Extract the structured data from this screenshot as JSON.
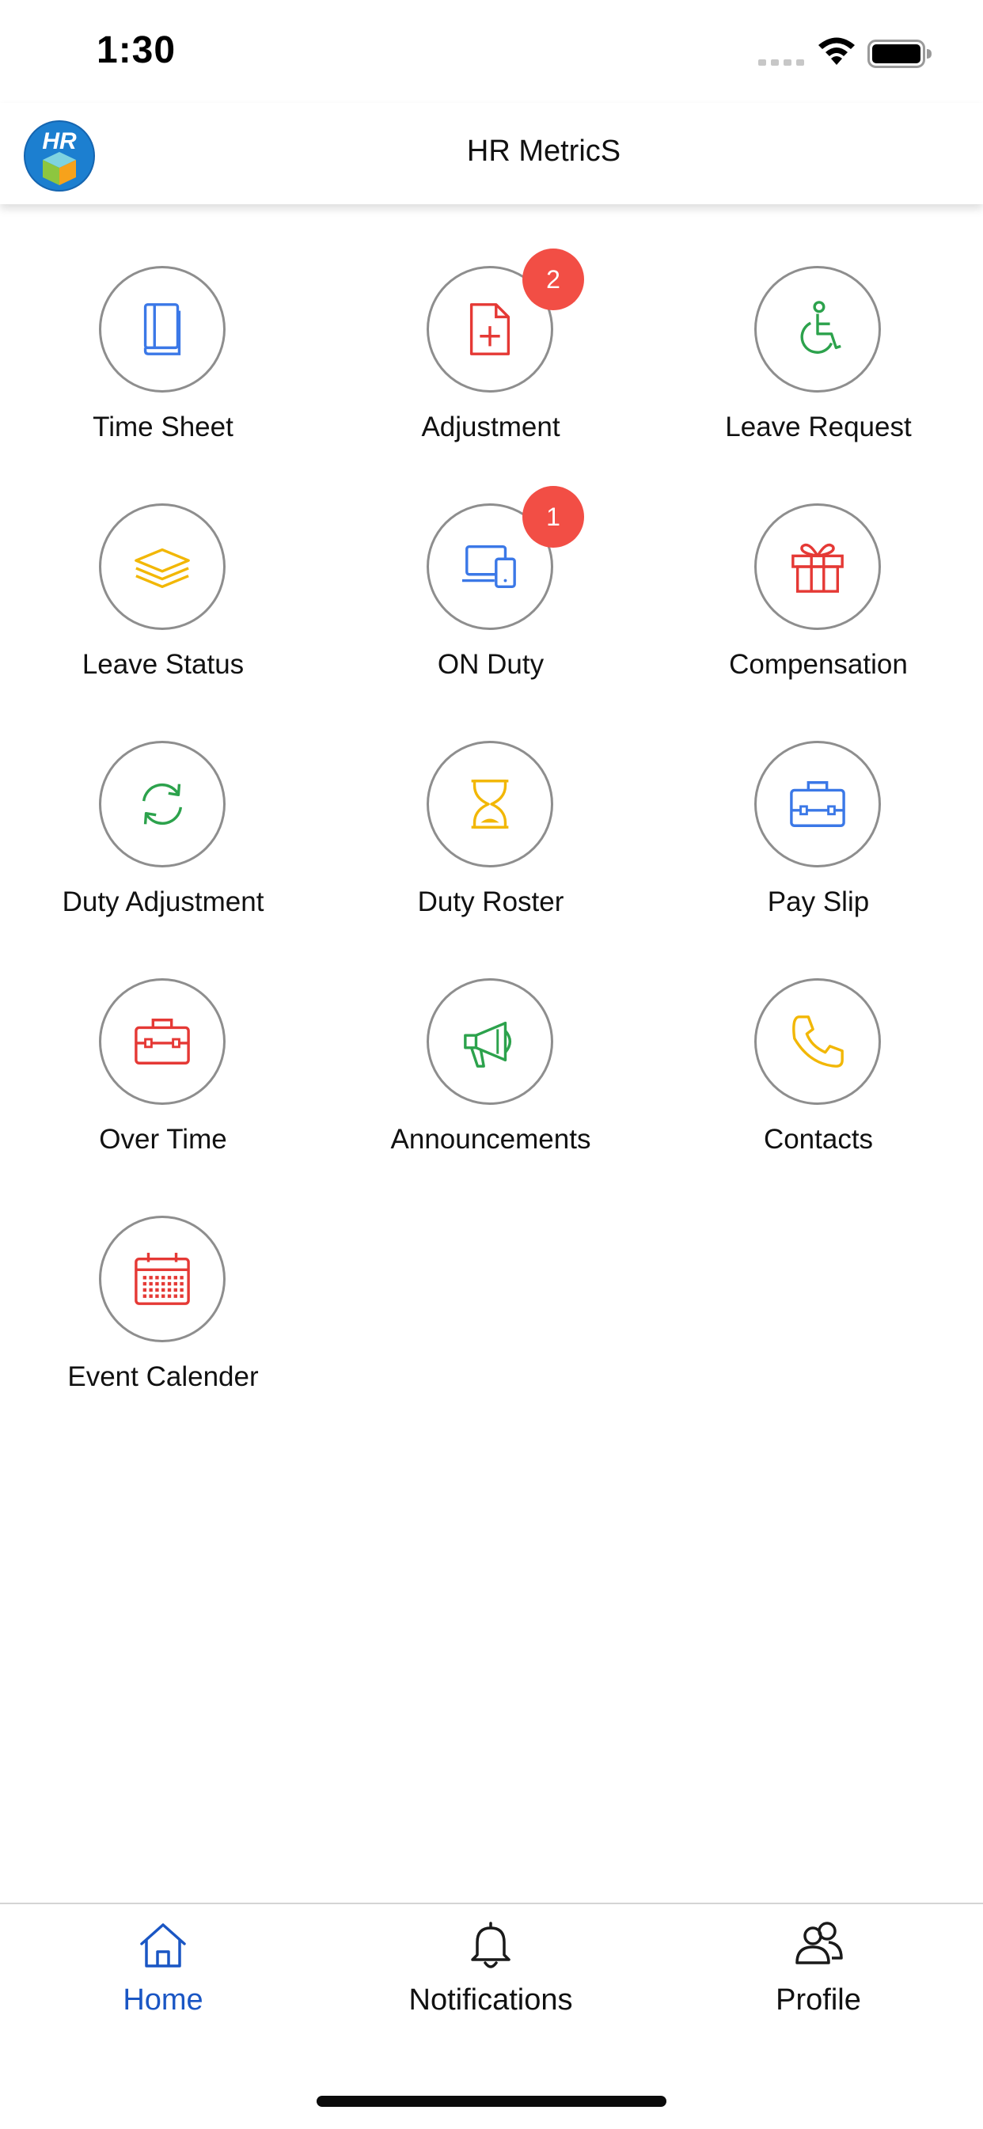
{
  "status_bar": {
    "time": "1:30"
  },
  "header": {
    "logo_text": "HR",
    "title": "HR MetricS"
  },
  "menu": [
    {
      "id": "time-sheet",
      "label": "Time Sheet",
      "icon": "book-icon",
      "color": "#3b78e7",
      "badge": ""
    },
    {
      "id": "adjustment",
      "label": "Adjustment",
      "icon": "document-plus-icon",
      "color": "#e53935",
      "badge": "2"
    },
    {
      "id": "leave-request",
      "label": "Leave Request",
      "icon": "wheelchair-icon",
      "color": "#2ca24c",
      "badge": ""
    },
    {
      "id": "leave-status",
      "label": "Leave Status",
      "icon": "layers-icon",
      "color": "#f2b705",
      "badge": ""
    },
    {
      "id": "on-duty",
      "label": "ON Duty",
      "icon": "devices-icon",
      "color": "#3b78e7",
      "badge": "1"
    },
    {
      "id": "compensation",
      "label": "Compensation",
      "icon": "gift-icon",
      "color": "#e53935",
      "badge": ""
    },
    {
      "id": "duty-adjustment",
      "label": "Duty Adjustment",
      "icon": "refresh-icon",
      "color": "#2ca24c",
      "badge": ""
    },
    {
      "id": "duty-roster",
      "label": "Duty Roster",
      "icon": "hourglass-icon",
      "color": "#f2b705",
      "badge": ""
    },
    {
      "id": "pay-slip",
      "label": "Pay Slip",
      "icon": "briefcase-icon",
      "color": "#3b78e7",
      "badge": ""
    },
    {
      "id": "over-time",
      "label": "Over Time",
      "icon": "toolbox-icon",
      "color": "#e53935",
      "badge": ""
    },
    {
      "id": "announcements",
      "label": "Announcements",
      "icon": "megaphone-icon",
      "color": "#2ca24c",
      "badge": ""
    },
    {
      "id": "contacts",
      "label": "Contacts",
      "icon": "phone-icon",
      "color": "#f2b705",
      "badge": ""
    },
    {
      "id": "event-calender",
      "label": "Event Calender",
      "icon": "calendar-icon",
      "color": "#e53935",
      "badge": ""
    }
  ],
  "tab_bar": {
    "active_color": "#1a56c4",
    "tabs": [
      {
        "id": "home",
        "label": "Home",
        "icon": "home-icon",
        "active": true
      },
      {
        "id": "notifications",
        "label": "Notifications",
        "icon": "bell-icon",
        "active": false
      },
      {
        "id": "profile",
        "label": "Profile",
        "icon": "users-icon",
        "active": false
      }
    ]
  }
}
